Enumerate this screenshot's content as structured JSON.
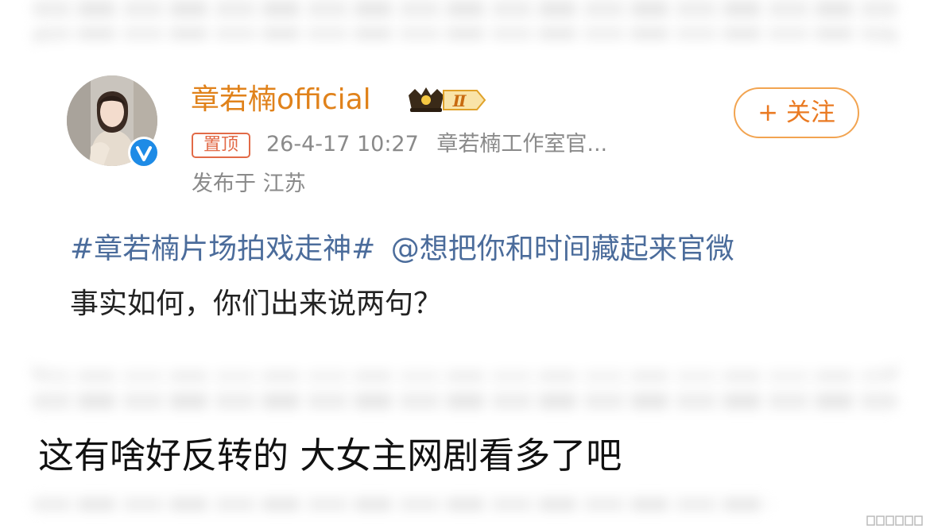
{
  "post": {
    "author": {
      "name": "章若楠official",
      "vip_level": "Ⅱ"
    },
    "follow_label": "+ 关注",
    "pinned_label": "置顶",
    "timestamp": "26-4-17 10:27",
    "source": "章若楠工作室官...",
    "location": "发布于 江苏",
    "hashtag": "#章若楠片场拍戏走神#",
    "mention": "@想把你和时间藏起来官微",
    "text": "事实如何，你们出来说两句？"
  },
  "caption": "这有啥好反转的 大女主网剧看多了吧",
  "colors": {
    "username": "#e0821b",
    "follow": "#ea7a22",
    "pin_tag": "#e26a47",
    "link": "#4b6c9b",
    "meta": "#8a8a8a",
    "verified": "#1e8be6"
  },
  "icons": {
    "verified": "verified-badge-icon",
    "vip": "crown-vip-badge-icon",
    "watermark": "watermark-icon"
  }
}
